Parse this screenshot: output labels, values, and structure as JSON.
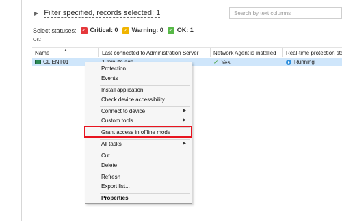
{
  "filter": {
    "label": "Filter specified, records selected: 1"
  },
  "search": {
    "placeholder": "Search by text columns"
  },
  "statuses": {
    "label": "Select statuses:",
    "items": [
      {
        "name": "Critical",
        "count": "0",
        "text": "Critical: 0",
        "color": "#e5383b"
      },
      {
        "name": "Warning",
        "count": "0",
        "text": "Warning: 0",
        "color": "#f0b400"
      },
      {
        "name": "OK",
        "count": "1",
        "text": "OK: 1",
        "color": "#57b947"
      }
    ],
    "ok_label": "OK:"
  },
  "table": {
    "columns": [
      "Name",
      "Last connected to Administration Server",
      "Network Agent is installed",
      "Real-time protection sta"
    ],
    "rows": [
      {
        "name": "CLIENT01",
        "last_connected": "1 minute ago",
        "agent": "Yes",
        "protection": "Running"
      }
    ]
  },
  "context_menu": {
    "items": [
      {
        "label": "Protection"
      },
      {
        "label": "Events"
      },
      {
        "label": "Install application"
      },
      {
        "label": "Check device accessibility"
      },
      {
        "label": "Connect to device",
        "submenu": true
      },
      {
        "label": "Custom tools",
        "submenu": true
      },
      {
        "label": "Grant access in offline mode",
        "highlighted": true
      },
      {
        "label": "All tasks",
        "submenu": true
      },
      {
        "label": "Cut"
      },
      {
        "label": "Delete"
      },
      {
        "label": "Refresh"
      },
      {
        "label": "Export list..."
      },
      {
        "label": "Properties",
        "bold": true
      }
    ]
  },
  "colors": {
    "selection": "#cfe6fb",
    "highlight_box": "#e8141f"
  }
}
